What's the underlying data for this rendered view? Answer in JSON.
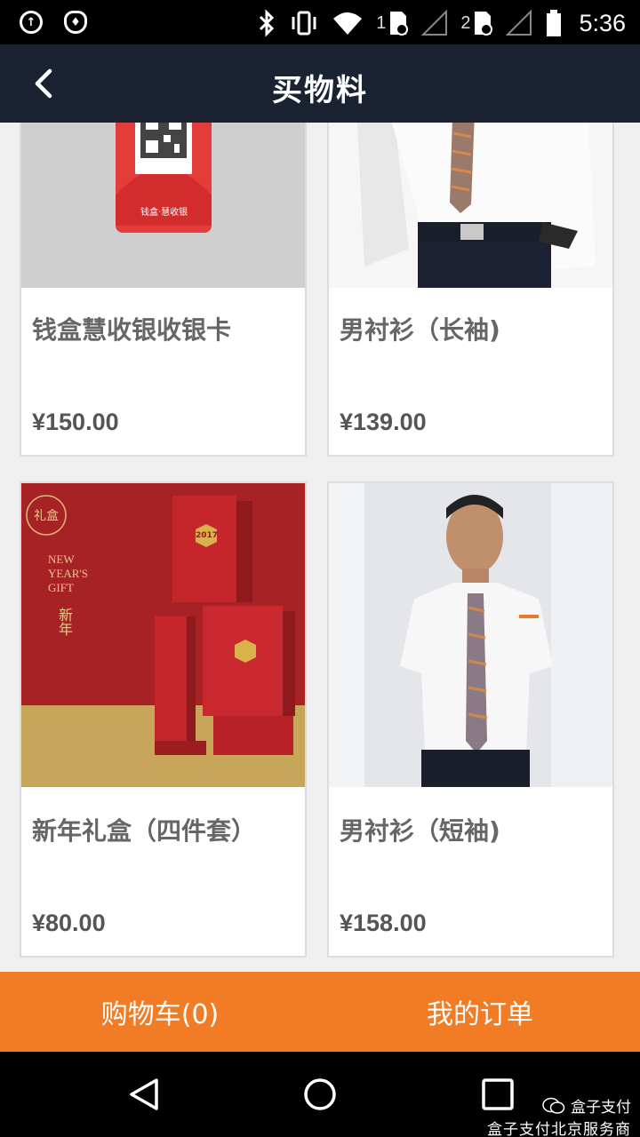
{
  "status_bar": {
    "time": "5:36",
    "sim1": "1",
    "sim2": "2",
    "icons": [
      "upload-icon",
      "shield-icon",
      "bluetooth-icon",
      "vibrate-icon",
      "wifi-icon",
      "sim-icon",
      "signal-icon",
      "battery-icon"
    ]
  },
  "app_bar": {
    "title": "买物料",
    "back_icon": "chevron-left-icon"
  },
  "products": [
    {
      "name": "钱盒慧收银收银卡",
      "price": "¥150.00",
      "image": "payment-card-image",
      "card_text": "钱盒·慧收银"
    },
    {
      "name": "男衬衫（长袖)",
      "price": "¥139.00",
      "image": "long-sleeve-shirt-image"
    },
    {
      "name": "新年礼盒（四件套）",
      "price": "¥80.00",
      "image": "gift-box-image",
      "img_texts": {
        "lihe": "礼盒",
        "newyear": "NEW",
        "years": "YEAR'S",
        "gift": "GIFT",
        "xinnian": "新年",
        "year": "2017"
      }
    },
    {
      "name": "男衬衫（短袖)",
      "price": "¥158.00",
      "image": "short-sleeve-shirt-image"
    }
  ],
  "actions": {
    "cart_label": "购物车(0)",
    "orders_label": "我的订单"
  },
  "watermark": {
    "line1": "盒子支付",
    "line2": "盒子支付北京服务商"
  },
  "colors": {
    "app_bar": "#1b2333",
    "action_bar": "#f27b26",
    "background": "#efefef"
  }
}
